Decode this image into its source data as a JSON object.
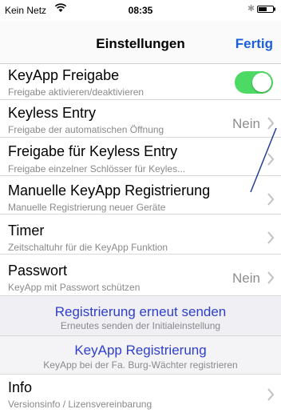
{
  "status": {
    "carrier": "Kein Netz",
    "time": "08:35"
  },
  "nav": {
    "title": "Einstellungen",
    "done": "Fertig"
  },
  "rows": {
    "freigabe": {
      "title": "KeyApp Freigabe",
      "sub": "Freigabe aktivieren/deaktivieren",
      "toggle_on": true
    },
    "keyless": {
      "title": "Keyless Entry",
      "sub": "Freigabe der automatischen Öffnung",
      "value": "Nein"
    },
    "freigabe_keyless": {
      "title": "Freigabe für Keyless Entry",
      "sub": "Freigabe einzelner Schlösser für Keyles..."
    },
    "manuell": {
      "title": "Manuelle KeyApp Registrierung",
      "sub": "Manuelle Registrierung neuer Geräte"
    },
    "timer": {
      "title": "Timer",
      "sub": "Zeitschaltuhr für die KeyApp Funktion"
    },
    "passwort": {
      "title": "Passwort",
      "sub": "KeyApp mit Passwort schützen",
      "value": "Nein"
    },
    "info": {
      "title": "Info",
      "sub": "Versionsinfo / Lizensvereinbarung"
    }
  },
  "actions": {
    "resend": {
      "title": "Registrierung erneut senden",
      "sub": "Erneutes senden der Initialeinstellung"
    },
    "register": {
      "title": "KeyApp Registrierung",
      "sub": "KeyApp bei der Fa. Burg-Wächter registrieren"
    }
  },
  "colors": {
    "accent": "#1a5fd8",
    "action_text": "#2f3fcc",
    "toggle_on": "#4cd964",
    "annotation_line": "#1f3f8f"
  },
  "icons": {
    "wifi": "wifi-icon",
    "bluetooth": "bluetooth-icon",
    "battery": "battery-icon",
    "chevron": "chevron-right-icon"
  }
}
